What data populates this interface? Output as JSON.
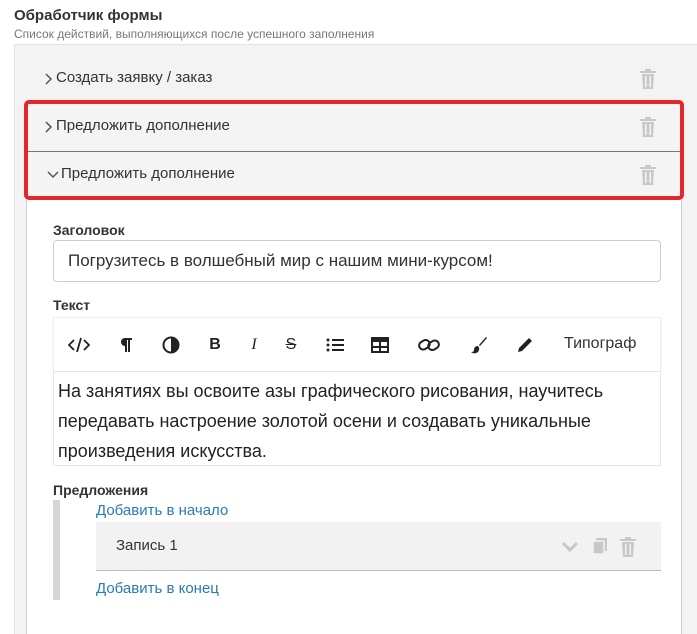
{
  "header": {
    "title": "Обработчик формы",
    "subtitle": "Список действий, выполняющихся после успешного заполнения"
  },
  "actions": [
    {
      "label": "Создать заявку / заказ",
      "expanded": false
    },
    {
      "label": "Предложить дополнение",
      "expanded": false
    },
    {
      "label": "Предложить дополнение",
      "expanded": true
    }
  ],
  "editor": {
    "title_label": "Заголовок",
    "title_value": "Погрузитесь в волшебный мир с нашим мини-курсом!",
    "text_label": "Текст",
    "toolbar": {
      "icons": [
        "code-icon",
        "paragraph-icon",
        "contrast-icon",
        "bold-icon",
        "italic-icon",
        "strikethrough-icon",
        "list-icon",
        "table-icon",
        "link-icon",
        "brush-icon",
        "pencil-icon"
      ],
      "typograf_label": "Типограф"
    },
    "text_value": "На занятиях вы освоите азы графического рисования, научитесь передавать настроение золотой осени и создавать уникальные произведения искусства.",
    "offers_label": "Предложения",
    "add_start": "Добавить в начало",
    "record_label": "Запись 1",
    "add_end": "Добавить в конец"
  },
  "colors": {
    "highlight": "#e0282d",
    "link": "#2a7ab7",
    "icon_muted": "#c8c8c8"
  }
}
